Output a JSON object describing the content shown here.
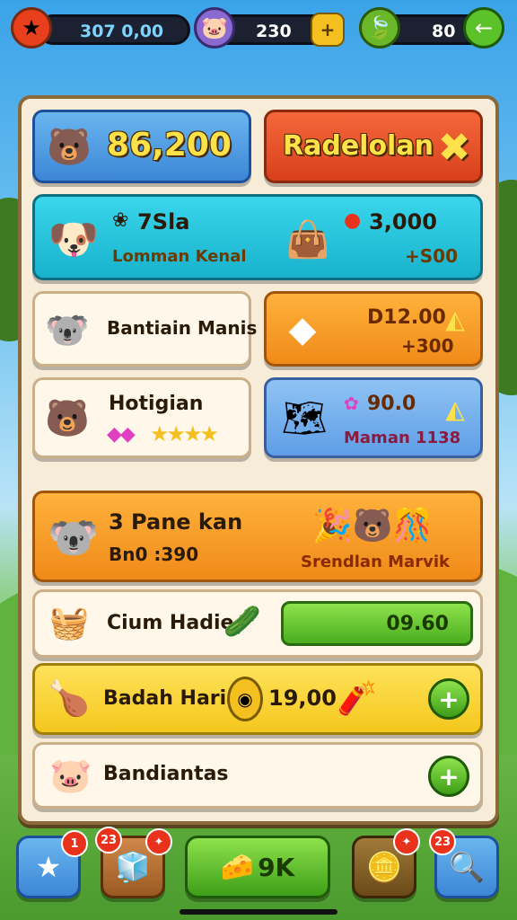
{
  "resources": {
    "coins": {
      "icon": "star-icon",
      "value": "307  0,00"
    },
    "gems": {
      "icon": "pig-icon",
      "value": "230"
    },
    "leaves": {
      "icon": "leaf-icon",
      "value": "80"
    }
  },
  "header_cards": {
    "score": {
      "value": "86,200",
      "icon": "bear-icon"
    },
    "action": {
      "label": "Radelolan",
      "icon": "cross-icon"
    }
  },
  "cyan_card": {
    "title": "7Sla",
    "subtitle": "Lomman Kenal",
    "price": "3,000",
    "sub_price": "+S00"
  },
  "row3": {
    "left_label": "Bantiain Manis",
    "right_price": "D12.00",
    "right_sub": "+300"
  },
  "row4": {
    "left_label": "Hotigian",
    "right_price": "90.0",
    "right_sub": "Maman 1138"
  },
  "orange_banner": {
    "title": "3 Pane kan",
    "sub": "Bn0 :390",
    "right_label": "Srendlan Marvik"
  },
  "row6": {
    "label": "Cium Hadie",
    "value": "09.60"
  },
  "row7": {
    "label": "Badah Hariar",
    "value": "19,00",
    "plus": "+"
  },
  "row8": {
    "label": "Bandiantas",
    "plus": "+"
  },
  "nav": {
    "badge1": "1",
    "badge2": "23",
    "badge3": "23",
    "ok_label": "9K"
  }
}
